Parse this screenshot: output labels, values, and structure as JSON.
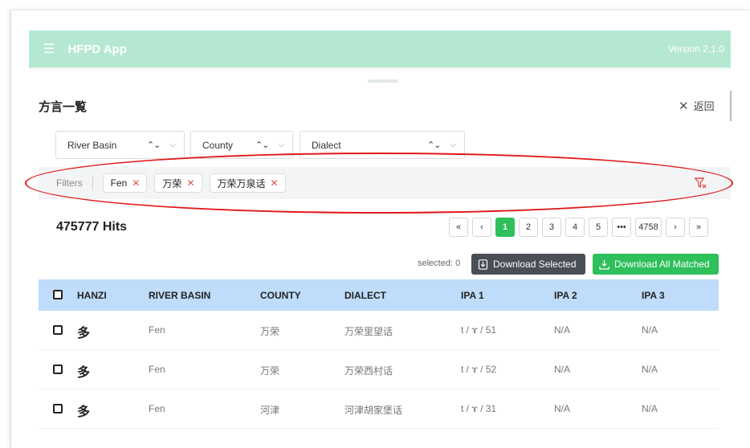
{
  "header": {
    "title": "HFPD App",
    "version": "Version 2.1.0"
  },
  "page": {
    "title": "方言一覧",
    "back_label": "返回"
  },
  "selects": [
    {
      "label": "River Basin"
    },
    {
      "label": "County"
    },
    {
      "label": "Dialect"
    }
  ],
  "filters": {
    "label": "Filters",
    "chips": [
      "Fen",
      "万荣",
      "万荣万泉话"
    ]
  },
  "results": {
    "hits": "475777 Hits"
  },
  "pagination": {
    "first": "«",
    "prev": "‹",
    "pages": [
      "1",
      "2",
      "3",
      "4",
      "5"
    ],
    "ellipsis": "•••",
    "last_page": "4758",
    "next": "›",
    "last": "»",
    "active": "1"
  },
  "actions": {
    "selected_text": "selected: 0",
    "download_selected": "Download Selected",
    "download_all": "Download All Matched"
  },
  "table": {
    "columns": [
      "HANZI",
      "RIVER BASIN",
      "COUNTY",
      "DIALECT",
      "IPA 1",
      "IPA 2",
      "IPA 3"
    ],
    "rows": [
      [
        "多",
        "Fen",
        "万荣",
        "万荣里望话",
        "t / ɤ / 51",
        "N/A",
        "N/A"
      ],
      [
        "多",
        "Fen",
        "万荣",
        "万荣西村话",
        "t / ɤ / 52",
        "N/A",
        "N/A"
      ],
      [
        "多",
        "Fen",
        "河津",
        "河津胡家堡话",
        "t / ɤ / 31",
        "N/A",
        "N/A"
      ]
    ]
  },
  "colors": {
    "header_bg": "#b5e8d1",
    "accent_green": "#2ec05b",
    "table_header_bg": "#bfdcfa",
    "annotation_red": "#e01818"
  }
}
